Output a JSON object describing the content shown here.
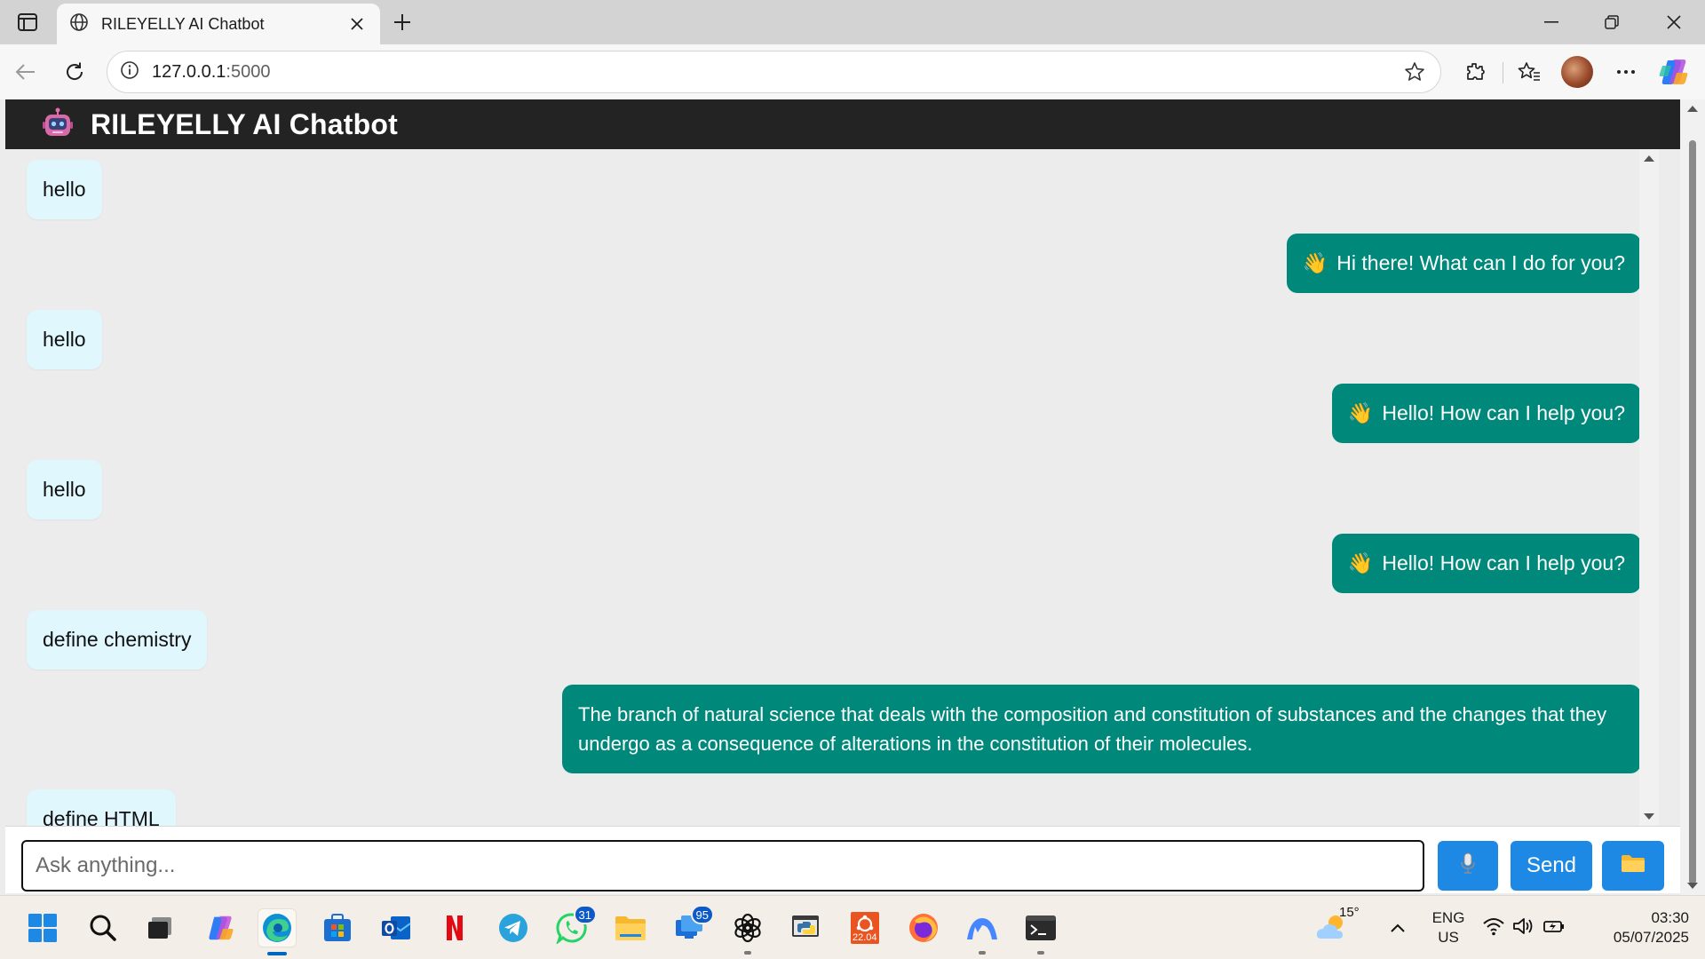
{
  "browser": {
    "tab_title": "RILEYELLY AI Chatbot",
    "url_host": "127.0.0.1",
    "url_port": ":5000"
  },
  "app": {
    "title": "RILEYELLY AI Chatbot",
    "icon": "robot-icon"
  },
  "messages": [
    {
      "role": "user",
      "text": "hello"
    },
    {
      "role": "bot",
      "emoji": "👋",
      "text": "Hi there! What can I do for you?"
    },
    {
      "role": "user",
      "text": "hello"
    },
    {
      "role": "bot",
      "emoji": "👋",
      "text": "Hello! How can I help you?"
    },
    {
      "role": "user",
      "text": "hello"
    },
    {
      "role": "bot",
      "emoji": "👋",
      "text": "Hello! How can I help you?"
    },
    {
      "role": "user",
      "text": "define chemistry"
    },
    {
      "role": "bot",
      "text": "The branch of natural science that deals with the composition and constitution of substances and the changes that they undergo as a consequence of alterations in the constitution of their molecules."
    },
    {
      "role": "user",
      "text": "define HTML"
    }
  ],
  "composer": {
    "placeholder": "Ask anything...",
    "mic_icon": "microphone-icon",
    "send_label": "Send",
    "folder_icon": "folder-icon"
  },
  "taskbar": {
    "whatsapp_badge": "31",
    "store_badge": "95",
    "ubuntu_label": "22.04",
    "weather_temp": "15°",
    "lang_primary": "ENG",
    "lang_secondary": "US",
    "time": "03:30",
    "date": "05/07/2025"
  },
  "colors": {
    "header_bg": "#232323",
    "user_bubble": "#dff7fd",
    "bot_bubble": "#00897b",
    "button_blue": "#1e88e5"
  }
}
